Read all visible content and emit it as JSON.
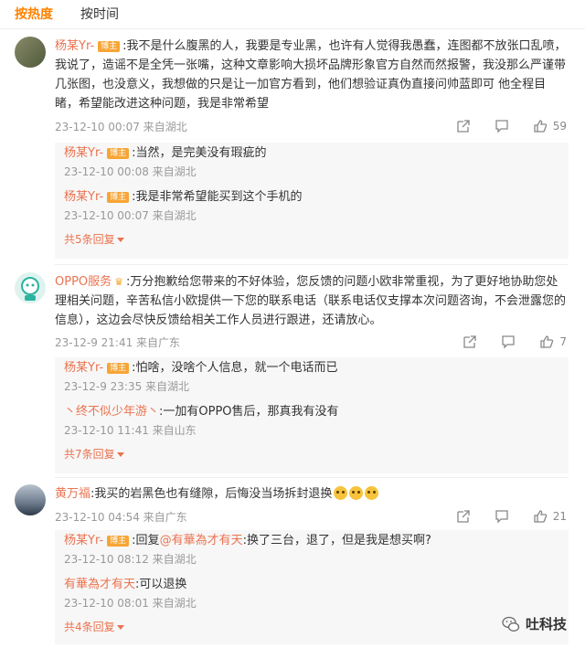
{
  "tabs": {
    "hot": "按热度",
    "time": "按时间"
  },
  "comments": [
    {
      "name": "杨某Yr-",
      "badge": "博主",
      "text": ":我不是什么腹黑的人，我要是专业黑，也许有人觉得我愚蠢，连图都不放张口乱喷，我说了，造谣不是全凭一张嘴，这种文章影响大损坏品牌形象官方自然而然报警，我没那么严谨带几张图，也没意义，我想做的只是让一加官方看到，他们想验证真伪直接问帅蓝即可 他全程目睹，希望能改进这种问题，我是非常希望",
      "meta": "23-12-10 00:07 来自湖北",
      "likes": "59",
      "replies": [
        {
          "name": "杨某Yr-",
          "badge": "博主",
          "text": ":当然，是完美没有瑕疵的",
          "meta": "23-12-10 00:08 来自湖北"
        },
        {
          "name": "杨某Yr-",
          "badge": "博主",
          "text": ":我是非常希望能买到这个手机的",
          "meta": "23-12-10 00:07 来自湖北"
        }
      ],
      "more": "共5条回复"
    },
    {
      "name": "OPPO服务",
      "text": ":万分抱歉给您带来的不好体验，您反馈的问题小欧非常重视，为了更好地协助您处理相关问题，辛苦私信小欧提供一下您的联系电话（联系电话仅支撑本次问题咨询，不会泄露您的信息），这边会尽快反馈给相关工作人员进行跟进，还请放心。",
      "meta": "23-12-9 21:41 来自广东",
      "likes": "7",
      "replies": [
        {
          "name": "杨某Yr-",
          "badge": "博主",
          "text": ":怕啥，没啥个人信息，就一个电话而已",
          "meta": "23-12-9 23:35 来自湖北"
        },
        {
          "name": "丶终不似少年游丶",
          "text": ":一加有OPPO售后，那真我有没有",
          "meta": "23-12-10 11:41 来自山东"
        }
      ],
      "more": "共7条回复"
    },
    {
      "name": "黄万福",
      "text": ":我买的岩黑色也有缝隙，后悔没当场拆封退换",
      "meta": "23-12-10 04:54 来自广东",
      "likes": "21",
      "replies": [
        {
          "name": "杨某Yr-",
          "badge": "博主",
          "text_prefix": ":回复",
          "mention": "@有華為才有天",
          "text": ":换了三台，退了，但是我是想买啊?",
          "meta": "23-12-10 08:12 来自湖北"
        },
        {
          "name": "有華為才有天",
          "text": ":可以退换",
          "meta": "23-12-10 08:01 来自湖北"
        }
      ],
      "more": "共4条回复"
    }
  ],
  "watermark": "吐科技",
  "colors": {
    "accent": "#ff8200",
    "username": "#eb7350",
    "badge": "#f7a535",
    "reply_bg": "#f7f7f7"
  },
  "icons": [
    "share-icon",
    "comment-icon",
    "like-icon",
    "wechat-icon"
  ]
}
